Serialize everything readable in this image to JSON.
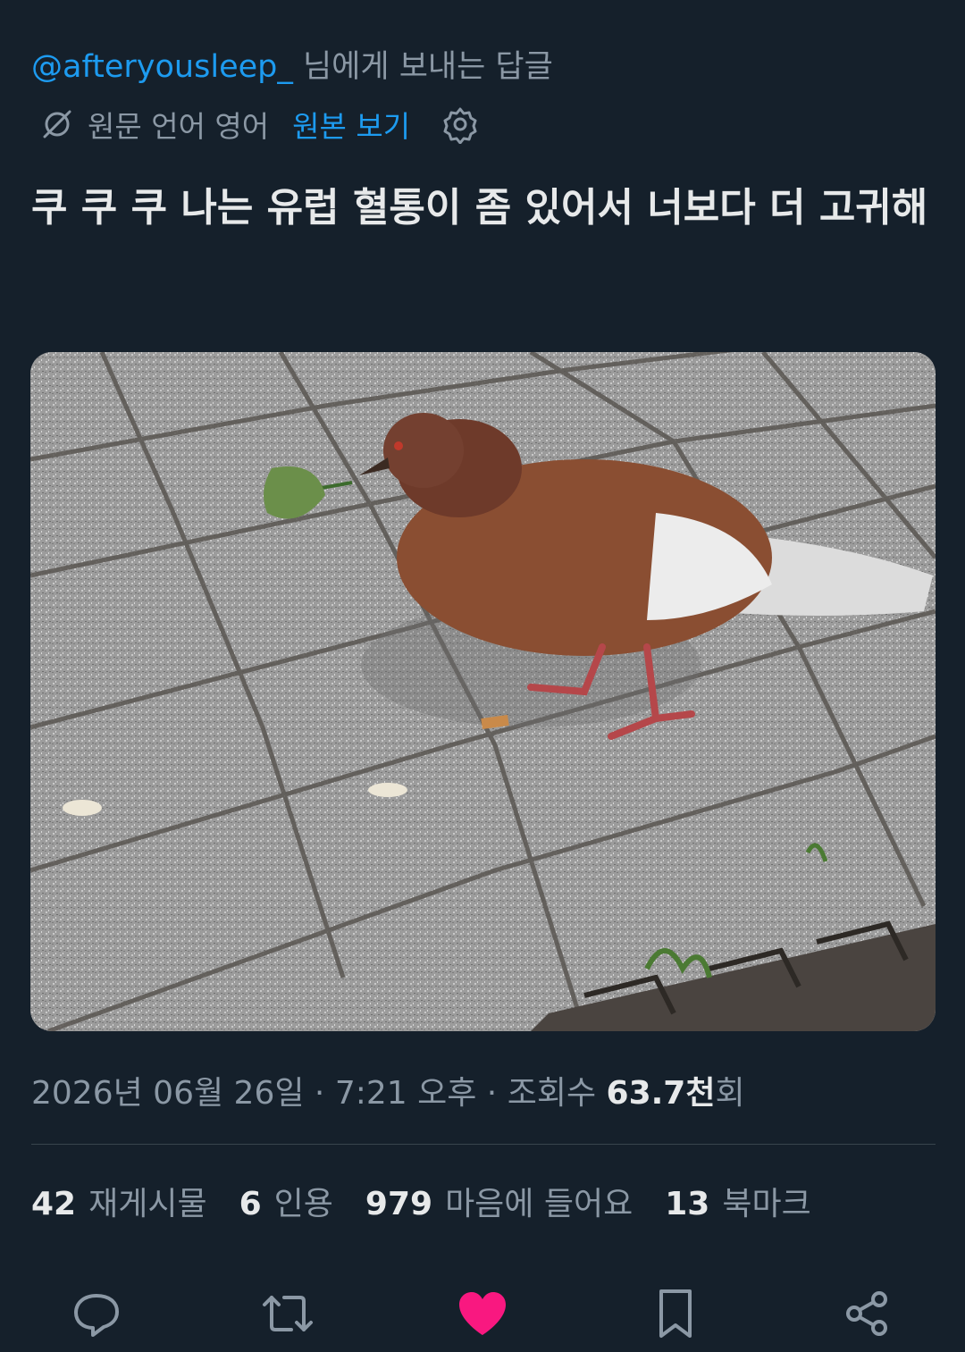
{
  "reply": {
    "handle": "@afteryousleep_",
    "suffix": " 님에게 보내는 답글"
  },
  "translation": {
    "icon": "translate-off-icon",
    "note": "원문 언어 영어",
    "show_original": "원본 보기",
    "settings_icon": "gear-icon"
  },
  "tweet": {
    "text": "쿠 쿠 쿠 나는 유럽 혈통이 좀 있어서 너보다 더 고귀해",
    "image": "photo of a brown and white pigeon holding a leaf on grey paving stones"
  },
  "meta": {
    "date": "2026년 06월 26일",
    "sep1": " · ",
    "time": "7:21 오후",
    "sep2": " · ",
    "views_label": "조회수 ",
    "views_count": "63.7천",
    "views_suffix": "회"
  },
  "stats": {
    "reposts": {
      "num": "42",
      "label": "재게시물"
    },
    "quotes": {
      "num": "6",
      "label": "인용"
    },
    "likes": {
      "num": "979",
      "label": "마음에 들어요"
    },
    "bookmarks": {
      "num": "13",
      "label": "북마크"
    }
  },
  "actions": {
    "reply_icon": "reply-icon",
    "repost_icon": "repost-icon",
    "like_icon": "heart-icon",
    "bookmark_icon": "bookmark-icon",
    "share_icon": "share-icon"
  },
  "colors": {
    "background": "#15202b",
    "accent": "#1d9bf0",
    "like": "#f91880",
    "muted": "#8b98a5"
  }
}
